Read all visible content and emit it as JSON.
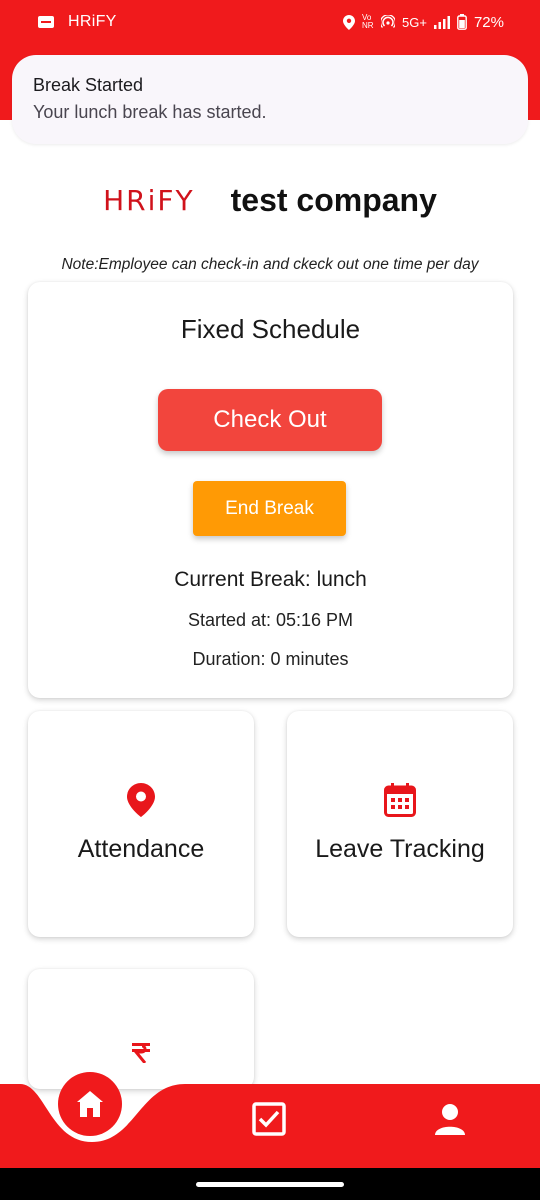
{
  "status_bar": {
    "app_name": "HRiFY",
    "network": "5G+",
    "volte": "Vo NR",
    "battery": "72%"
  },
  "notification": {
    "title": "Break Started",
    "body": "Your lunch break has started."
  },
  "header": {
    "brand": "HRiFY",
    "company": "test company"
  },
  "note": "Note:Employee can check-in and ckeck out one time per day",
  "schedule": {
    "title": "Fixed Schedule",
    "check_out_label": "Check Out",
    "end_break_label": "End Break",
    "current_break": "Current Break: lunch",
    "started_at": "Started at: 05:16 PM",
    "duration": "Duration: 0 minutes"
  },
  "tiles": [
    {
      "label": "Attendance",
      "icon": "location-pin-icon"
    },
    {
      "label": "Leave Tracking",
      "icon": "calendar-icon"
    },
    {
      "label": "",
      "icon": "rupee-icon"
    }
  ],
  "bottom_nav": [
    {
      "icon": "home-icon"
    },
    {
      "icon": "checkbox-icon"
    },
    {
      "icon": "profile-icon"
    }
  ],
  "colors": {
    "brand_red": "#f01a1c",
    "checkout_red": "#f2453d",
    "end_break_orange": "#ff9a05",
    "icon_red": "#e8161b"
  }
}
